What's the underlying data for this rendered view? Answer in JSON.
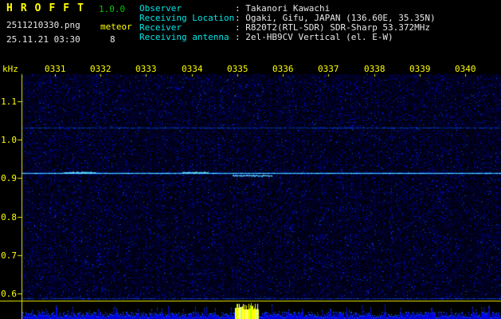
{
  "header": {
    "app_title": "HROFFT",
    "version": "1.0.0",
    "filename": "2511210330.png",
    "mode": "meteor",
    "datetime": "25.11.21 03:30",
    "count": "8",
    "info_rows": [
      {
        "label": "Observer",
        "value": "Takanori Kawachi"
      },
      {
        "label": "Receiving Location",
        "value": "Ogaki, Gifu, JAPAN (136.60E, 35.35N)"
      },
      {
        "label": "Receiver",
        "value": "R820T2(RTL-SDR) SDR-Sharp 53.372MHz"
      },
      {
        "label": "Receiving antenna",
        "value": "2el-HB9CV Vertical (el. E-W)"
      }
    ]
  },
  "chart_data": {
    "type": "heatmap",
    "description": "HROFFT radio meteor echo spectrogram (time vs audio frequency) with signal-level bar strip at bottom",
    "x_ticks": [
      "0331",
      "0332",
      "0333",
      "0334",
      "0335",
      "0336",
      "0337",
      "0338",
      "0339",
      "0340"
    ],
    "x_unit": "hhmm",
    "y_label": "kHz",
    "y_ticks": [
      "1.1",
      "1.0",
      "0.9",
      "0.8",
      "0.7",
      "0.6"
    ],
    "y_range_khz": [
      0.58,
      1.17
    ],
    "legend": "off",
    "grid": "off",
    "colors": {
      "background": "#000000",
      "axis": "#e8e800",
      "tick_label": "#ffff00",
      "carrier": "#80ffff",
      "echo": "#a0ffff",
      "bar": "#0000e6",
      "bar_tip": "#0096ff"
    },
    "carrier_lines": [
      {
        "freq_khz": 0.913,
        "strength": "strong"
      },
      {
        "freq_khz": 1.031,
        "strength": "faint"
      },
      {
        "freq_khz": 0.588,
        "strength": "faint"
      }
    ],
    "meteor_echoes": [
      {
        "start_min": 31.2,
        "end_min": 31.9,
        "freq_khz": 0.916
      },
      {
        "start_min": 33.8,
        "end_min": 34.35,
        "freq_khz": 0.915
      },
      {
        "start_min": 34.9,
        "end_min": 35.75,
        "freq_khz": 0.907
      }
    ],
    "level_strip": {
      "bar_color": "#0000e6",
      "burst": {
        "start_min": 34.95,
        "end_min": 35.45,
        "colors": [
          "#ffff00",
          "#ffffff",
          "#b4ff00"
        ]
      }
    }
  }
}
